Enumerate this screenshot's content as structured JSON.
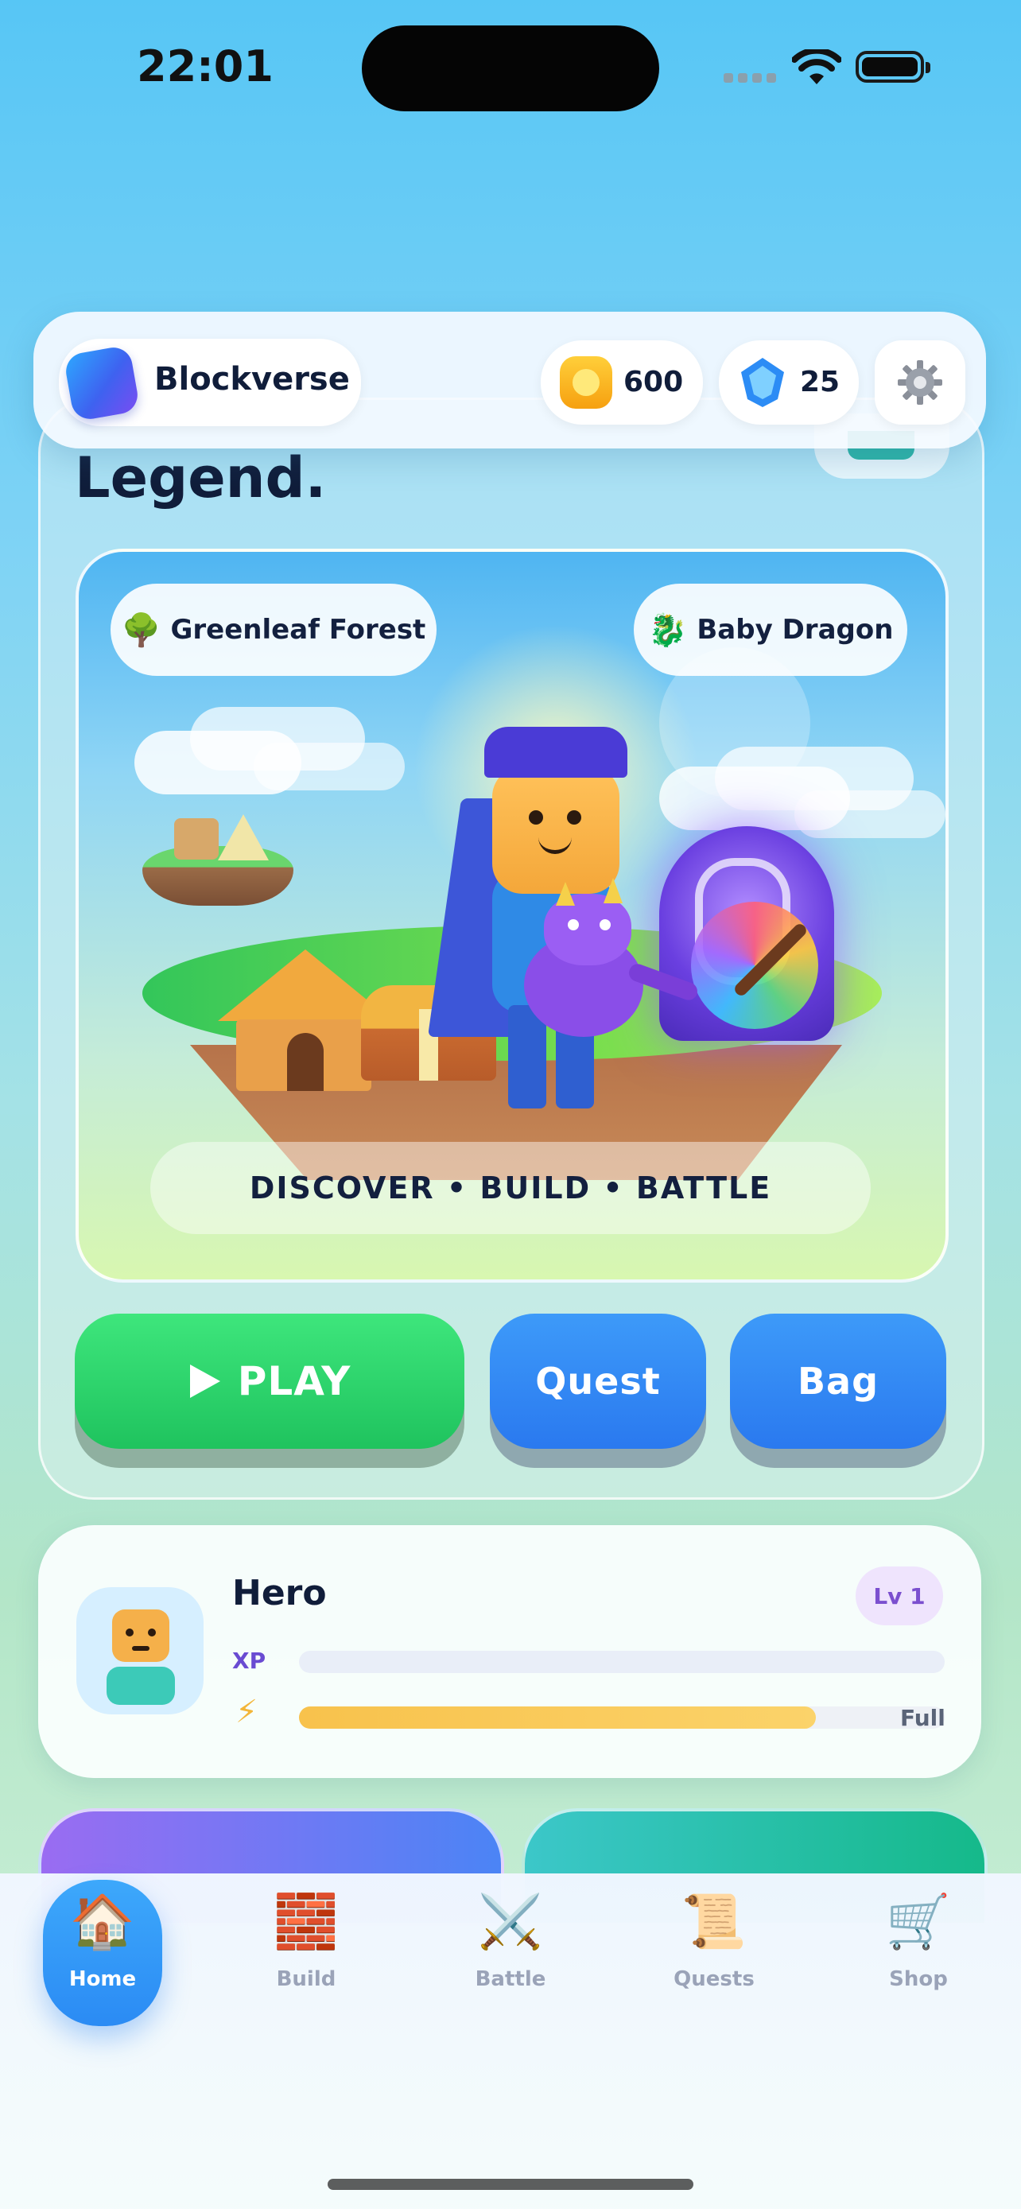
{
  "status_bar": {
    "time": "22:01"
  },
  "header": {
    "app_name": "Blockverse",
    "coins": "600",
    "gems": "25",
    "icons": {
      "coin": "coin-icon",
      "gem": "gem-icon",
      "settings": "gear-icon",
      "logo": "app-logo-icon"
    }
  },
  "main": {
    "title": "Legend.",
    "location_tag": "Greenleaf Forest",
    "location_icon": "tree-icon",
    "pet_tag": "Baby Dragon",
    "pet_icon": "dragon-icon",
    "tagline": "DISCOVER • BUILD • BATTLE",
    "actions": {
      "play": "PLAY",
      "quest": "Quest",
      "bag": "Bag"
    }
  },
  "hero": {
    "name": "Hero",
    "level": "Lv 1",
    "xp_label": "XP",
    "xp_progress": 0,
    "energy_icon": "lightning-icon",
    "energy_progress": 0.8,
    "energy_status": "Full"
  },
  "nav": {
    "items": [
      {
        "label": "Home",
        "icon": "house-icon",
        "active": true
      },
      {
        "label": "Build",
        "icon": "bricks-icon",
        "active": false
      },
      {
        "label": "Battle",
        "icon": "crossed-swords-icon",
        "active": false
      },
      {
        "label": "Quests",
        "icon": "scroll-icon",
        "active": false
      },
      {
        "label": "Shop",
        "icon": "cart-icon",
        "active": false
      }
    ]
  },
  "colors": {
    "play": "#22c863",
    "secondary_button": "#2f86f7",
    "energy_bar": "#f8c24c",
    "level_badge": "#7b4fcf"
  }
}
